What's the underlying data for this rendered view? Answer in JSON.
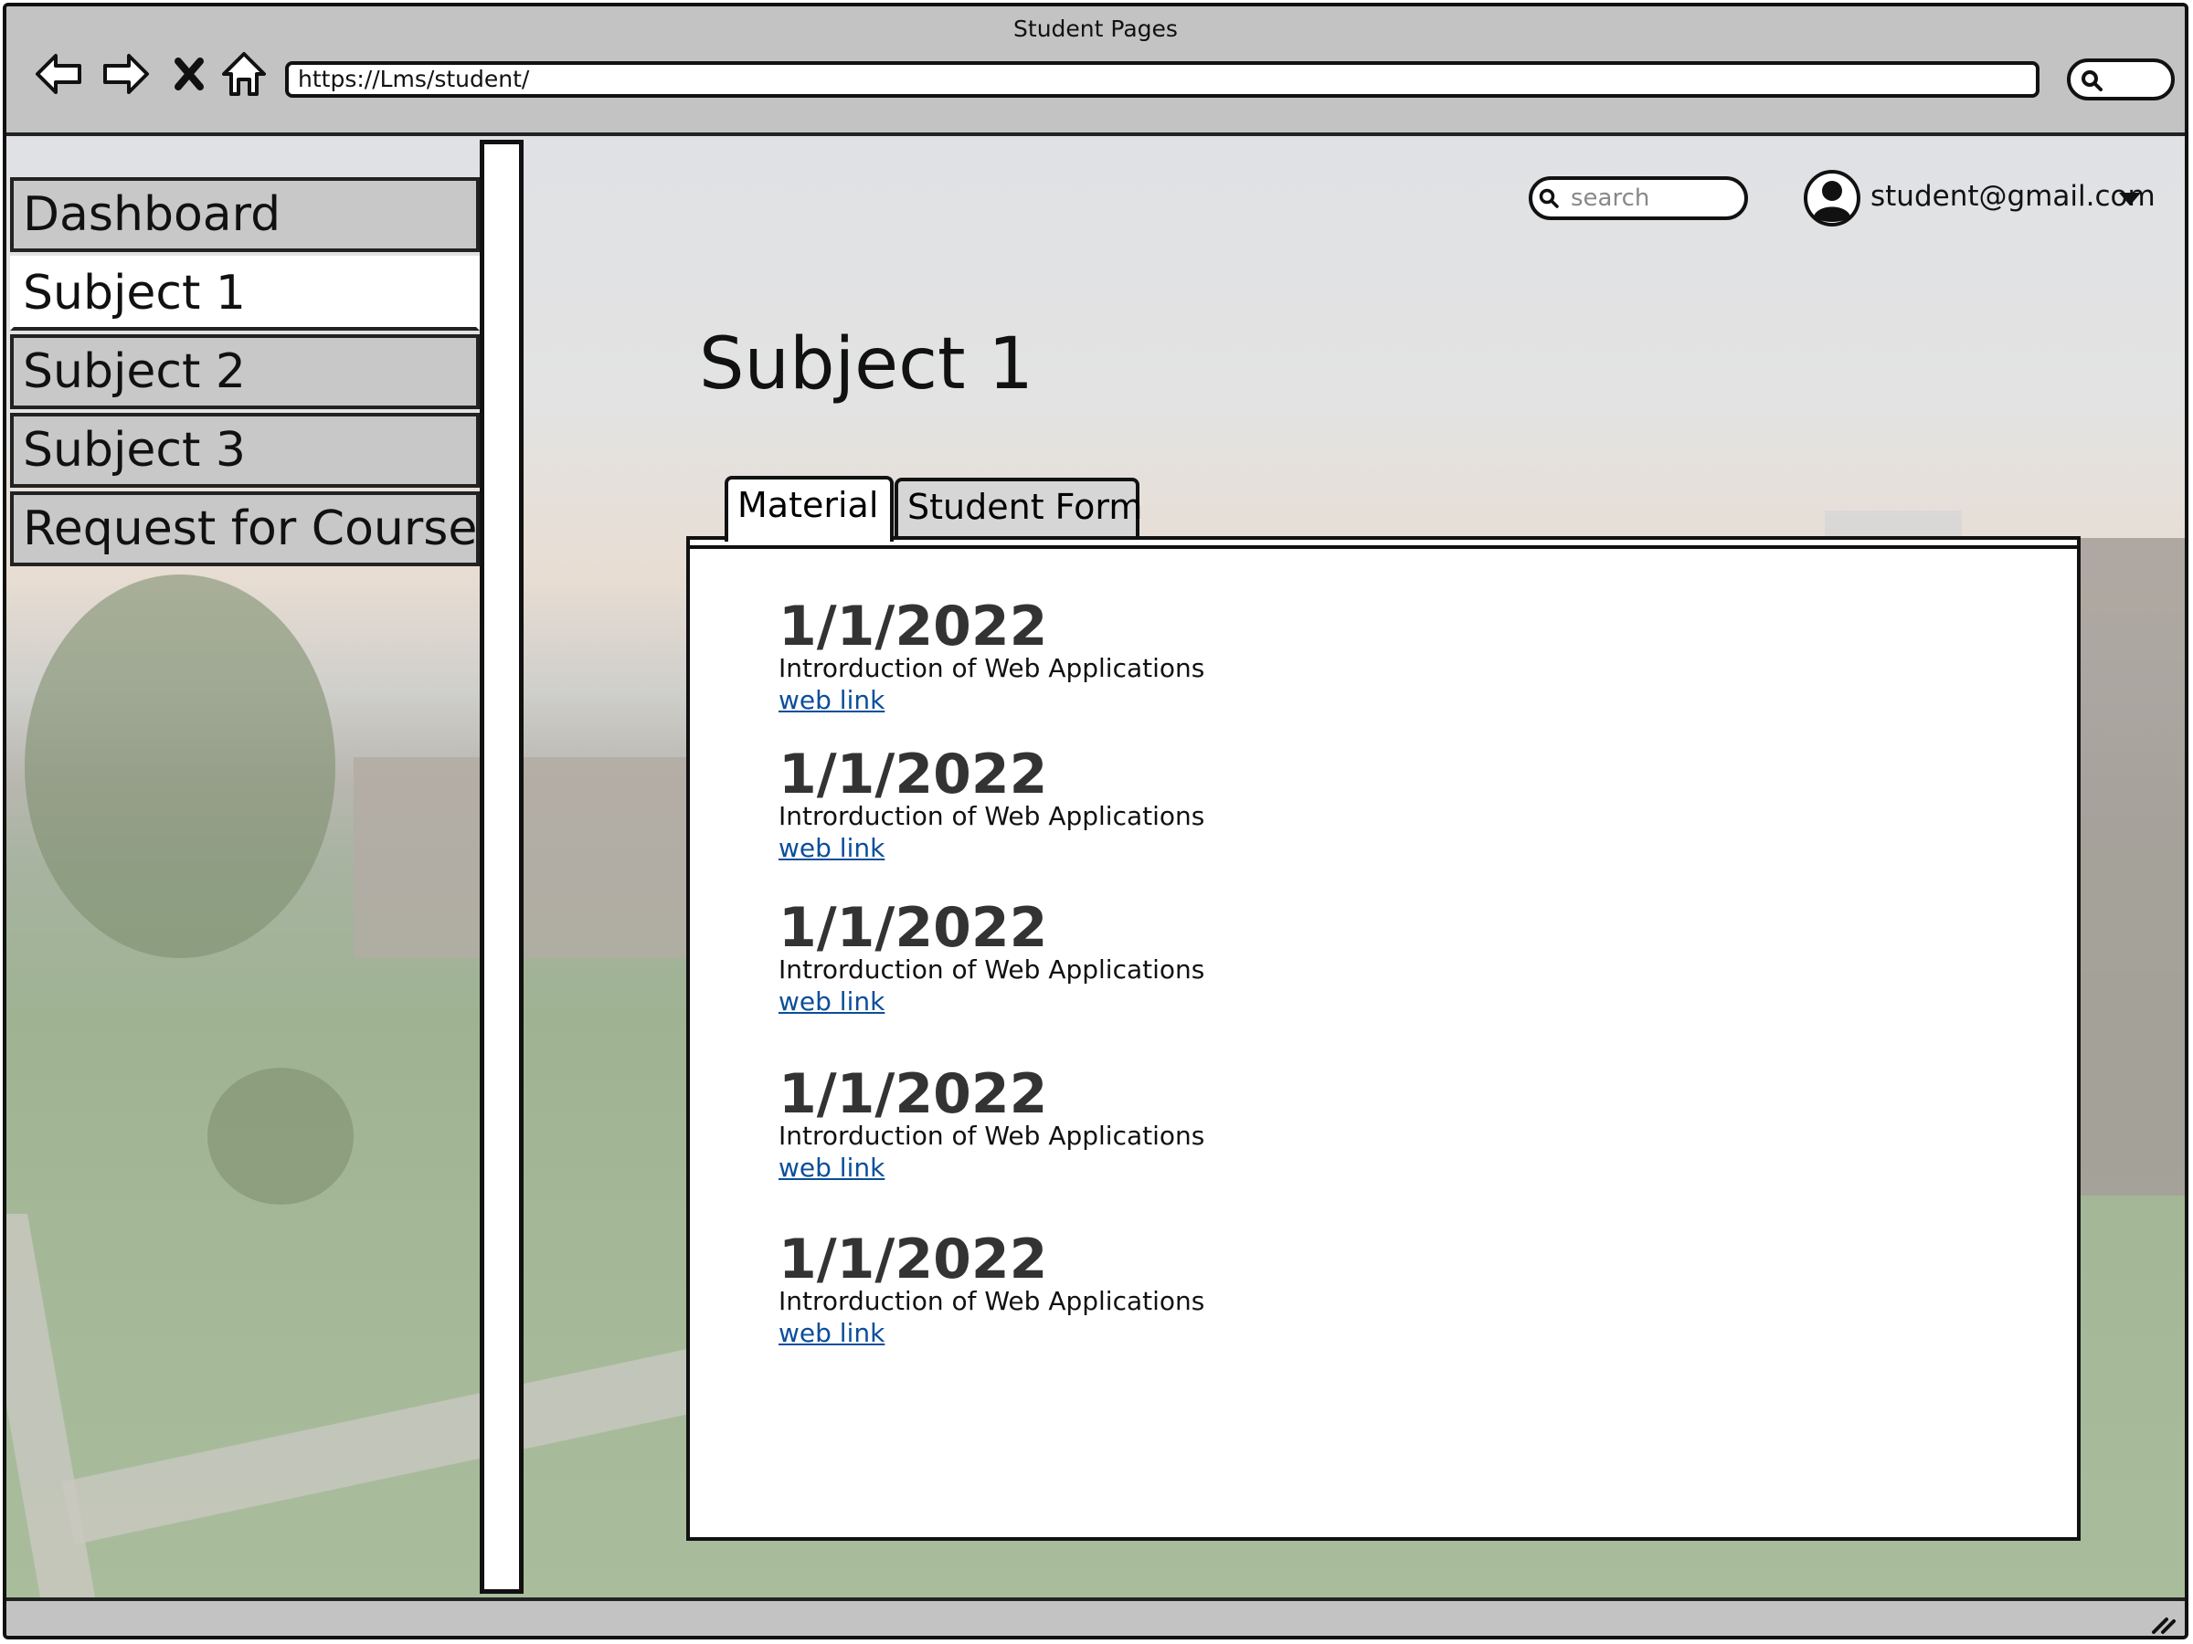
{
  "window": {
    "title": "Student Pages",
    "address": "https://Lms/student/"
  },
  "browser_controls": [
    "back-icon",
    "forward-icon",
    "close-icon",
    "home-icon",
    "search-icon"
  ],
  "sidebar": {
    "items": [
      {
        "label": "Dashboard",
        "active": false
      },
      {
        "label": "Subject 1",
        "active": true
      },
      {
        "label": "Subject 2",
        "active": false
      },
      {
        "label": "Subject 3",
        "active": false
      },
      {
        "label": "Request for Course",
        "active": false
      }
    ]
  },
  "header": {
    "search_placeholder": "search",
    "user_email": "student@gmail.com"
  },
  "main": {
    "title": "Subject 1",
    "tabs": [
      {
        "label": "Material",
        "active": true
      },
      {
        "label": "Student Form",
        "active": false
      }
    ],
    "materials": [
      {
        "date": "1/1/2022",
        "description": "Introrduction of Web Applications",
        "link": "web link"
      },
      {
        "date": "1/1/2022",
        "description": "Introrduction of Web Applications",
        "link": "web link"
      },
      {
        "date": "1/1/2022",
        "description": "Introrduction of Web Applications",
        "link": "web link"
      },
      {
        "date": "1/1/2022",
        "description": "Introrduction of Web Applications",
        "link": "web link"
      },
      {
        "date": "1/1/2022",
        "description": "Introrduction of Web Applications",
        "link": "web link"
      }
    ]
  },
  "colors": {
    "link": "#0b4e9a",
    "chrome": "#c3c3c3",
    "sidebar_item": "#c8c8c8"
  }
}
